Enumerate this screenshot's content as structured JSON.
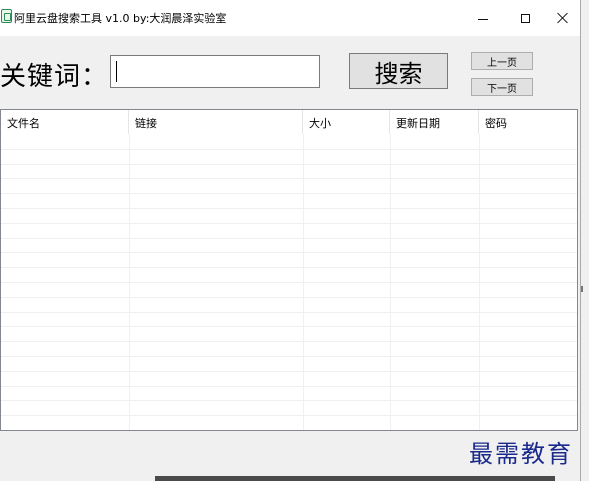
{
  "window": {
    "title": "阿里云盘搜索工具 v1.0  by:大润晨泽实验室",
    "icon": "app-icon",
    "controls": {
      "minimize": "minimize-icon",
      "maximize": "maximize-icon",
      "close": "close-icon"
    }
  },
  "search": {
    "label": "关键词：",
    "value": "",
    "button_label": "搜索"
  },
  "pagination": {
    "prev_label": "上一页",
    "next_label": "下一页"
  },
  "results": {
    "columns": [
      "文件名",
      "链接",
      "大小",
      "更新日期",
      "密码"
    ],
    "rows": []
  },
  "watermark": "最需教育",
  "colors": {
    "watermark": "#1a2a8c",
    "window_bg": "#f0f0f0",
    "button_bg": "#e1e1e1"
  }
}
